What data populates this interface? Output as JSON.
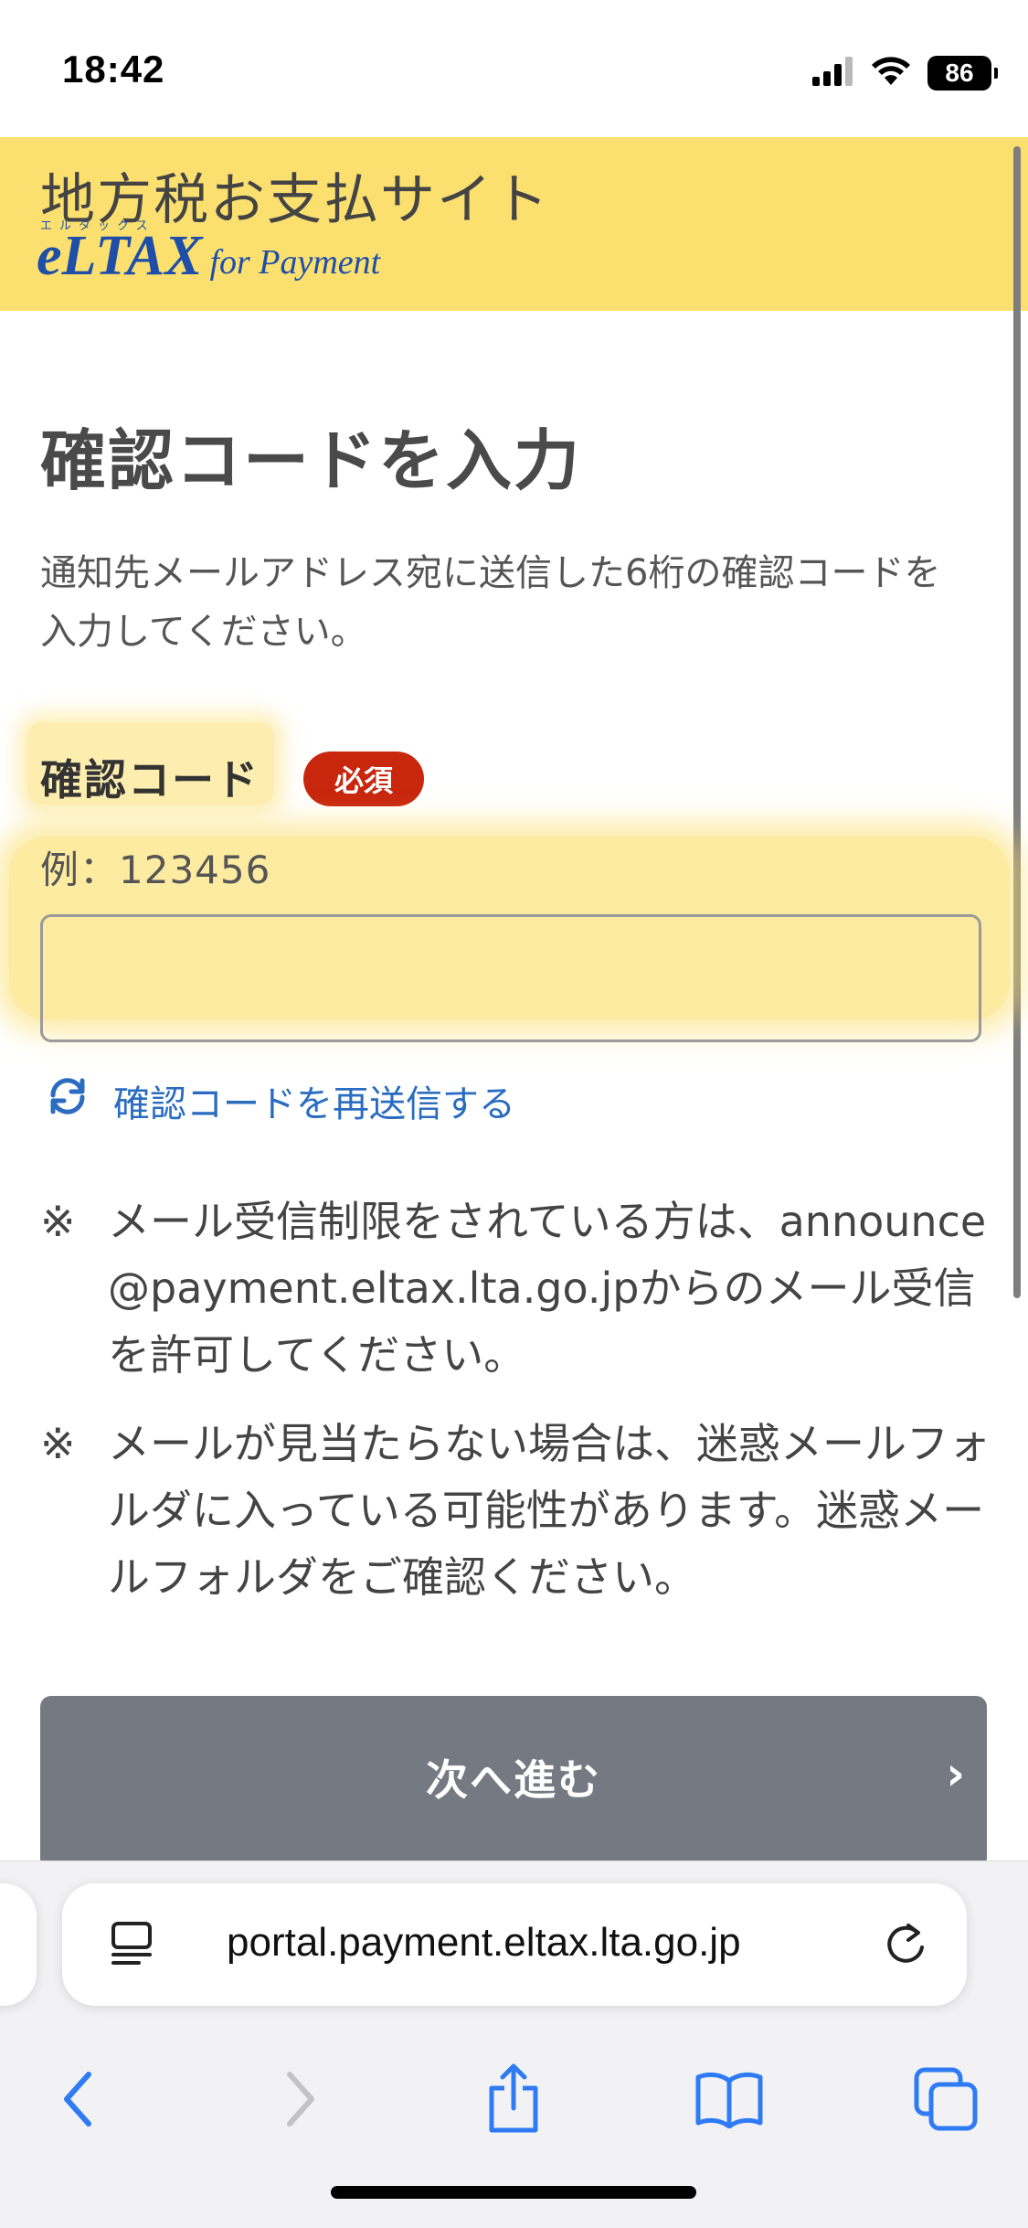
{
  "status_bar": {
    "time": "18:42",
    "battery": "86",
    "icons": [
      "cellular-signal-icon",
      "wifi-icon",
      "battery-icon"
    ]
  },
  "header": {
    "site_title": "地方税お支払サイト",
    "logo_mark": "eLTAX",
    "logo_kana": "エルタックス",
    "logo_sub": "for Payment",
    "background_color": "#fbe06f"
  },
  "main": {
    "title": "確認コードを入力",
    "description": "通知先メールアドレス宛に送信した6桁の確認コードを入力してください。",
    "field": {
      "label": "確認コード",
      "required_badge": "必須",
      "hint": "例：123456",
      "value": "",
      "placeholder": ""
    },
    "resend_link": "確認コードを再送信する",
    "notes": [
      {
        "mark": "※",
        "text": "メール受信制限をされている方は、announce@payment.eltax.lta.go.jpからのメール受信を許可してください。"
      },
      {
        "mark": "※",
        "text": "メールが見当たらない場合は、迷惑メールフォルダに入っている可能性があります。迷惑メールフォルダをご確認ください。"
      }
    ],
    "next_button": "次へ進む",
    "accent_color": "#2a6cc0",
    "required_color": "#c8260d"
  },
  "browser": {
    "url": "portal.payment.eltax.lta.go.jp",
    "toolbar": [
      "back-icon",
      "forward-icon",
      "share-icon",
      "bookmarks-icon",
      "tabs-icon"
    ]
  }
}
